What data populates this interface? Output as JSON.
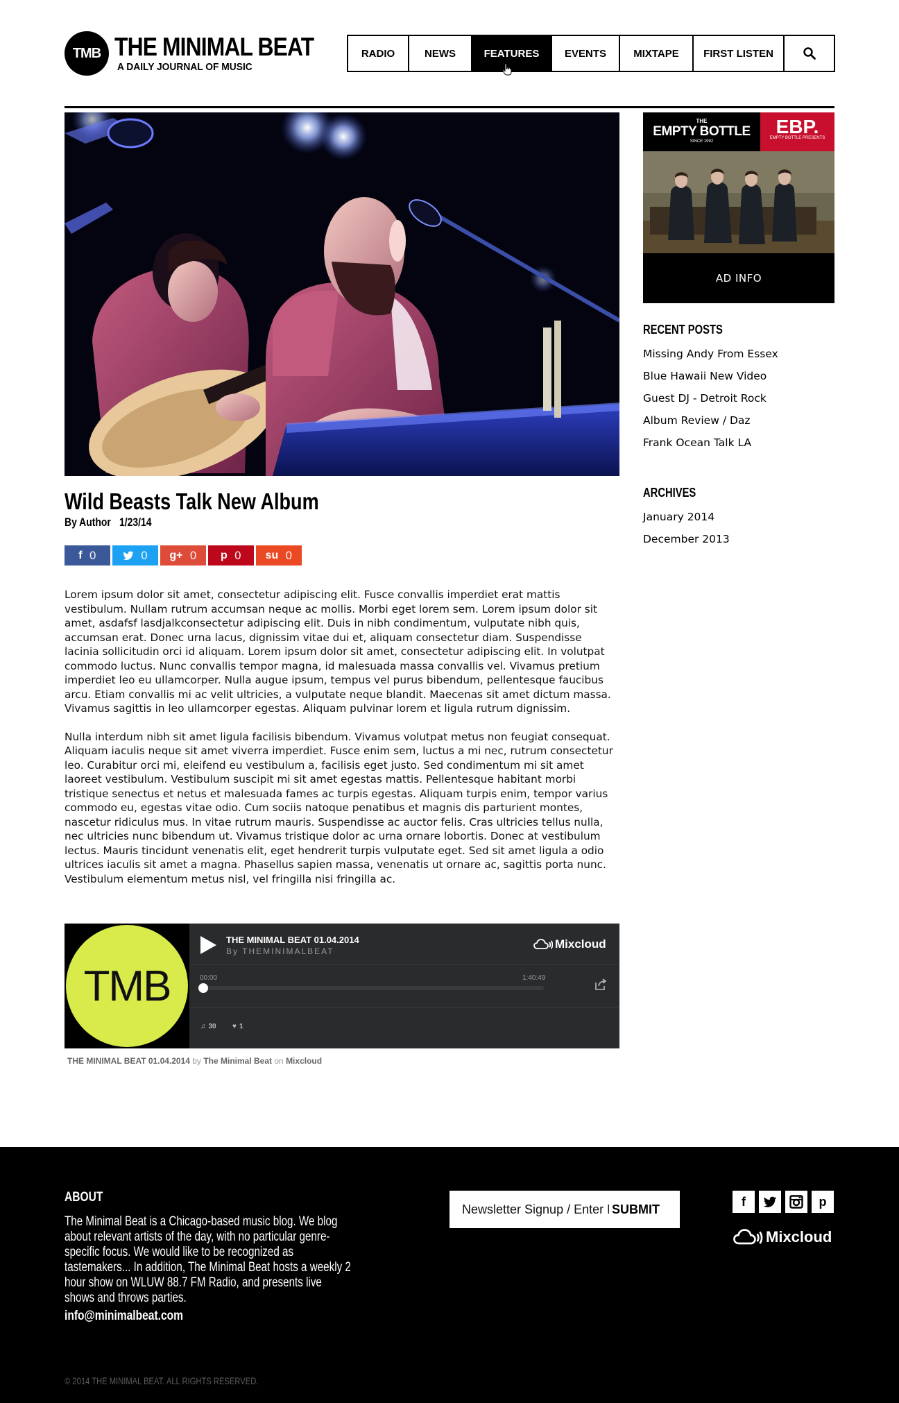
{
  "site": {
    "logo_mark": "TMB",
    "name": "THE MINIMAL BEAT",
    "tagline": "A DAILY JOURNAL OF MUSIC"
  },
  "nav": {
    "items": [
      {
        "label": "RADIO"
      },
      {
        "label": "NEWS"
      },
      {
        "label": "FEATURES",
        "active": true
      },
      {
        "label": "EVENTS"
      },
      {
        "label": "MIXTAPE"
      },
      {
        "label": "FIRST LISTEN"
      }
    ],
    "search_icon": "search-icon"
  },
  "post": {
    "title": "Wild Beasts Talk New Album",
    "author": "By Author",
    "date": "1/23/14",
    "share": [
      {
        "network": "facebook",
        "glyph": "f",
        "count": "0",
        "color": "#3b5998"
      },
      {
        "network": "twitter",
        "glyph": "t",
        "count": "0",
        "color": "#1da1f2"
      },
      {
        "network": "google-plus",
        "glyph": "g+",
        "count": "0",
        "color": "#dd4b39"
      },
      {
        "network": "pinterest",
        "glyph": "p",
        "count": "0",
        "color": "#bd081c"
      },
      {
        "network": "stumbleupon",
        "glyph": "su",
        "count": "0",
        "color": "#eb4924"
      }
    ],
    "paragraphs": [
      "Lorem ipsum dolor sit amet, consectetur adipiscing elit. Fusce convallis imperdiet erat mattis vestibulum. Nullam rutrum accumsan neque ac mollis. Morbi eget lorem sem. Lorem ipsum dolor sit amet, asdafsf lasdjalkconsectetur adipiscing elit. Duis in nibh condimentum, vulputate nibh quis, accumsan erat. Donec urna lacus, dignissim vitae dui et, aliquam consectetur diam. Suspendisse lacinia sollicitudin orci id aliquam. Lorem ipsum dolor sit amet, consectetur adipiscing elit. In volutpat commodo luctus. Nunc convallis tempor magna, id malesuada massa convallis vel. Vivamus pretium imperdiet leo eu ullamcorper. Nulla augue ipsum, tempus vel purus bibendum, pellentesque faucibus arcu. Etiam convallis mi ac velit ultricies, a vulputate neque blandit. Maecenas sit amet dictum massa. Vivamus sagittis in leo ullamcorper egestas. Aliquam pulvinar lorem et ligula rutrum dignissim.",
      "Nulla interdum nibh sit amet ligula facilisis bibendum. Vivamus volutpat metus non feugiat consequat. Aliquam iaculis neque sit amet viverra imperdiet. Fusce enim sem, luctus a mi nec, rutrum consectetur leo. Curabitur orci mi, eleifend eu vestibulum a, facilisis eget justo. Sed condimentum mi sit amet laoreet vestibulum. Vestibulum suscipit mi sit amet egestas mattis. Pellentesque habitant morbi tristique senectus et netus et malesuada fames ac turpis egestas. Aliquam turpis enim, tempor varius commodo eu, egestas vitae odio. Cum sociis natoque penatibus et magnis dis parturient montes, nascetur ridiculus mus. In vitae rutrum mauris. Suspendisse ac auctor felis. Cras ultricies tellus nulla, nec ultricies nunc bibendum ut. Vivamus tristique dolor ac urna ornare lobortis. Donec at vestibulum lectus. Mauris tincidunt venenatis elit, eget hendrerit turpis vulputate eget. Sed sit amet ligula a odio ultrices iaculis sit amet a magna. Phasellus sapien massa, venenatis ut ornare ac, sagittis porta nunc. Vestibulum elementum metus nisl, vel fringilla nisi fringilla ac."
    ]
  },
  "player": {
    "art_label": "TMB",
    "art_color": "#d9ea4b",
    "title": "THE MINIMAL BEAT 01.04.2014",
    "by": "By THEMINIMALBEAT",
    "brand": "Mixcloud",
    "time_start": "00:00",
    "time_end": "1:40:49",
    "progress": 0,
    "plays": "30",
    "likes": "1",
    "caption": {
      "show": "THE MINIMAL BEAT 01.04.2014",
      "by_word": "by",
      "owner": "The Minimal Beat",
      "on_word": "on",
      "platform": "Mixcloud"
    }
  },
  "sidebar": {
    "ad": {
      "eb_the": "THE",
      "eb_name": "EMPTY BOTTLE",
      "eb_since": "SINCE 1992",
      "ebp_mark": "EBP.",
      "ebp_sub": "EMPTY BOTTLE PRESENTS",
      "brand_red": "#c8102e",
      "info_label": "AD INFO"
    },
    "recent_heading": "RECENT POSTS",
    "recent_posts": [
      "Missing Andy From Essex",
      "Blue Hawaii New Video",
      "Guest DJ - Detroit Rock",
      "Album Review / Daz",
      "Frank Ocean Talk LA"
    ],
    "archives_heading": "ARCHIVES",
    "archives": [
      "January 2014",
      "December 2013"
    ]
  },
  "footer": {
    "about_heading": "ABOUT",
    "about_text": "The Minimal Beat is a Chicago-based music blog. We blog about relevant artists of the day, with no particular genre-specific focus. We would like to be recognized as tastemakers... In addition, The Minimal Beat hosts a weekly 2 hour show on WLUW 88.7 FM Radio, and presents live shows and throws parties.",
    "email": "info@minimalbeat.com",
    "newsletter_placeholder": "Newsletter Signup / Enter Email",
    "submit_label": "SUBMIT",
    "social": [
      {
        "name": "facebook-icon",
        "glyph": "f"
      },
      {
        "name": "twitter-icon",
        "glyph": "t"
      },
      {
        "name": "instagram-icon",
        "glyph": "◙"
      },
      {
        "name": "pinterest-icon",
        "glyph": "p"
      }
    ],
    "mixcloud": "Mixcloud",
    "copyright": "© 2014 THE MINIMAL BEAT. ALL RIGHTS RESERVED."
  }
}
